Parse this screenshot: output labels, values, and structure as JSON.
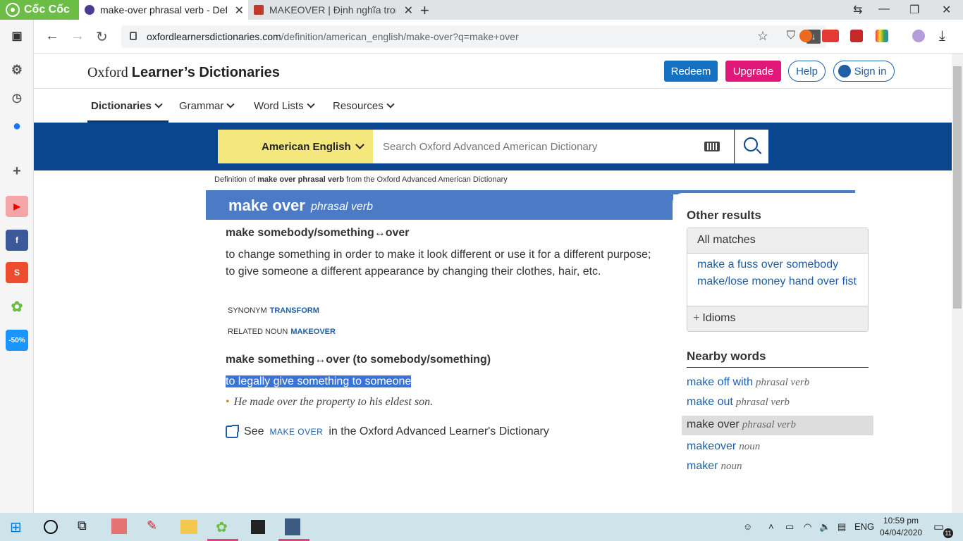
{
  "browser": {
    "brand": "Cốc Cốc",
    "tabs": [
      {
        "title": "make-over phrasal verb - Definition",
        "active": true
      },
      {
        "title": "MAKEOVER | Định nghĩa trong",
        "active": false
      }
    ],
    "url_host": "oxfordlearnersdictionaries.com",
    "url_path": "/definition/american_english/make-over?q=make+over"
  },
  "site": {
    "title_serif": "Oxford",
    "title_bold": "Learner’s Dictionaries",
    "redeem": "Redeem",
    "upgrade": "Upgrade",
    "help": "Help",
    "signin": "Sign in",
    "menu": [
      "Dictionaries",
      "Grammar",
      "Word Lists",
      "Resources"
    ],
    "lang": "American English",
    "search_placeholder": "Search Oxford Advanced American Dictionary"
  },
  "entry": {
    "source_prefix": "Definition of ",
    "source_bold": "make over phrasal verb",
    "source_suffix": " from the Oxford Advanced American Dictionary",
    "headword": "make over",
    "pos": "phrasal verb",
    "sense1": {
      "head": "make somebody/something↔over",
      "def": "to change something in order to make it look different or use it for a different purpose; to give someone a different appearance by changing their clothes, hair, etc.",
      "synonym_label": "SYNONYM",
      "synonym": "TRANSFORM",
      "related_label": "RELATED NOUN",
      "related": "MAKEOVER"
    },
    "sense2": {
      "head": "make something↔over (to somebody/something)",
      "def": "to legally give something to someone",
      "example": "He made over the property to his eldest son."
    },
    "see_also": {
      "prefix": "See",
      "link": "make over",
      "suffix": "in the Oxford Advanced Learner's Dictionary"
    }
  },
  "sidebar_right": {
    "other_results": "Other results",
    "all_matches": "All matches",
    "matches": [
      "make a fuss over somebody",
      "make/lose money hand over fist"
    ],
    "idioms": "Idioms",
    "nearby_title": "Nearby words",
    "nearby": [
      {
        "word": "make off with",
        "pos": "phrasal verb"
      },
      {
        "word": "make out",
        "pos": "phrasal verb"
      },
      {
        "word": "make over",
        "pos": "phrasal verb"
      },
      {
        "word": "makeover",
        "pos": "noun"
      },
      {
        "word": "maker",
        "pos": "noun"
      }
    ]
  },
  "taskbar": {
    "lang": "ENG",
    "time": "10:59 pm",
    "date": "04/04/2020",
    "notif_count": "11"
  }
}
